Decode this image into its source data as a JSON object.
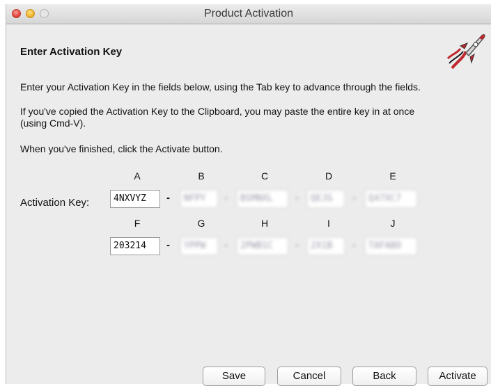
{
  "window": {
    "title": "Product Activation"
  },
  "heading": "Enter Activation Key",
  "instructions": {
    "p1": "Enter your Activation Key in the fields below, using the Tab key to advance through the fields.",
    "p2a": "If you've copied the Activation Key to the Clipboard, you may paste the entire key in at once",
    "p2b": "(using Cmd-V).",
    "p3": "When you've finished, click the Activate button."
  },
  "key": {
    "label": "Activation Key:",
    "row1_columns": [
      "A",
      "B",
      "C",
      "D",
      "E"
    ],
    "row2_columns": [
      "F",
      "G",
      "H",
      "I",
      "J"
    ],
    "row1_values": [
      "4NXVYZ",
      "NFPY",
      "BSMNXL",
      "QEJG",
      "Q47XC7"
    ],
    "row2_values": [
      "203214",
      "YPPW",
      "2PWB1C",
      "2X1B",
      "TAFABO"
    ],
    "separator": "-"
  },
  "buttons": {
    "save": "Save",
    "cancel": "Cancel",
    "back": "Back",
    "activate": "Activate"
  },
  "icons": {
    "rocket": "rocket-icon"
  },
  "colors": {
    "window_bg": "#ececec",
    "titlebar": "#d6d6d6",
    "close": "#e0443e",
    "minimize": "#f0b42d"
  }
}
